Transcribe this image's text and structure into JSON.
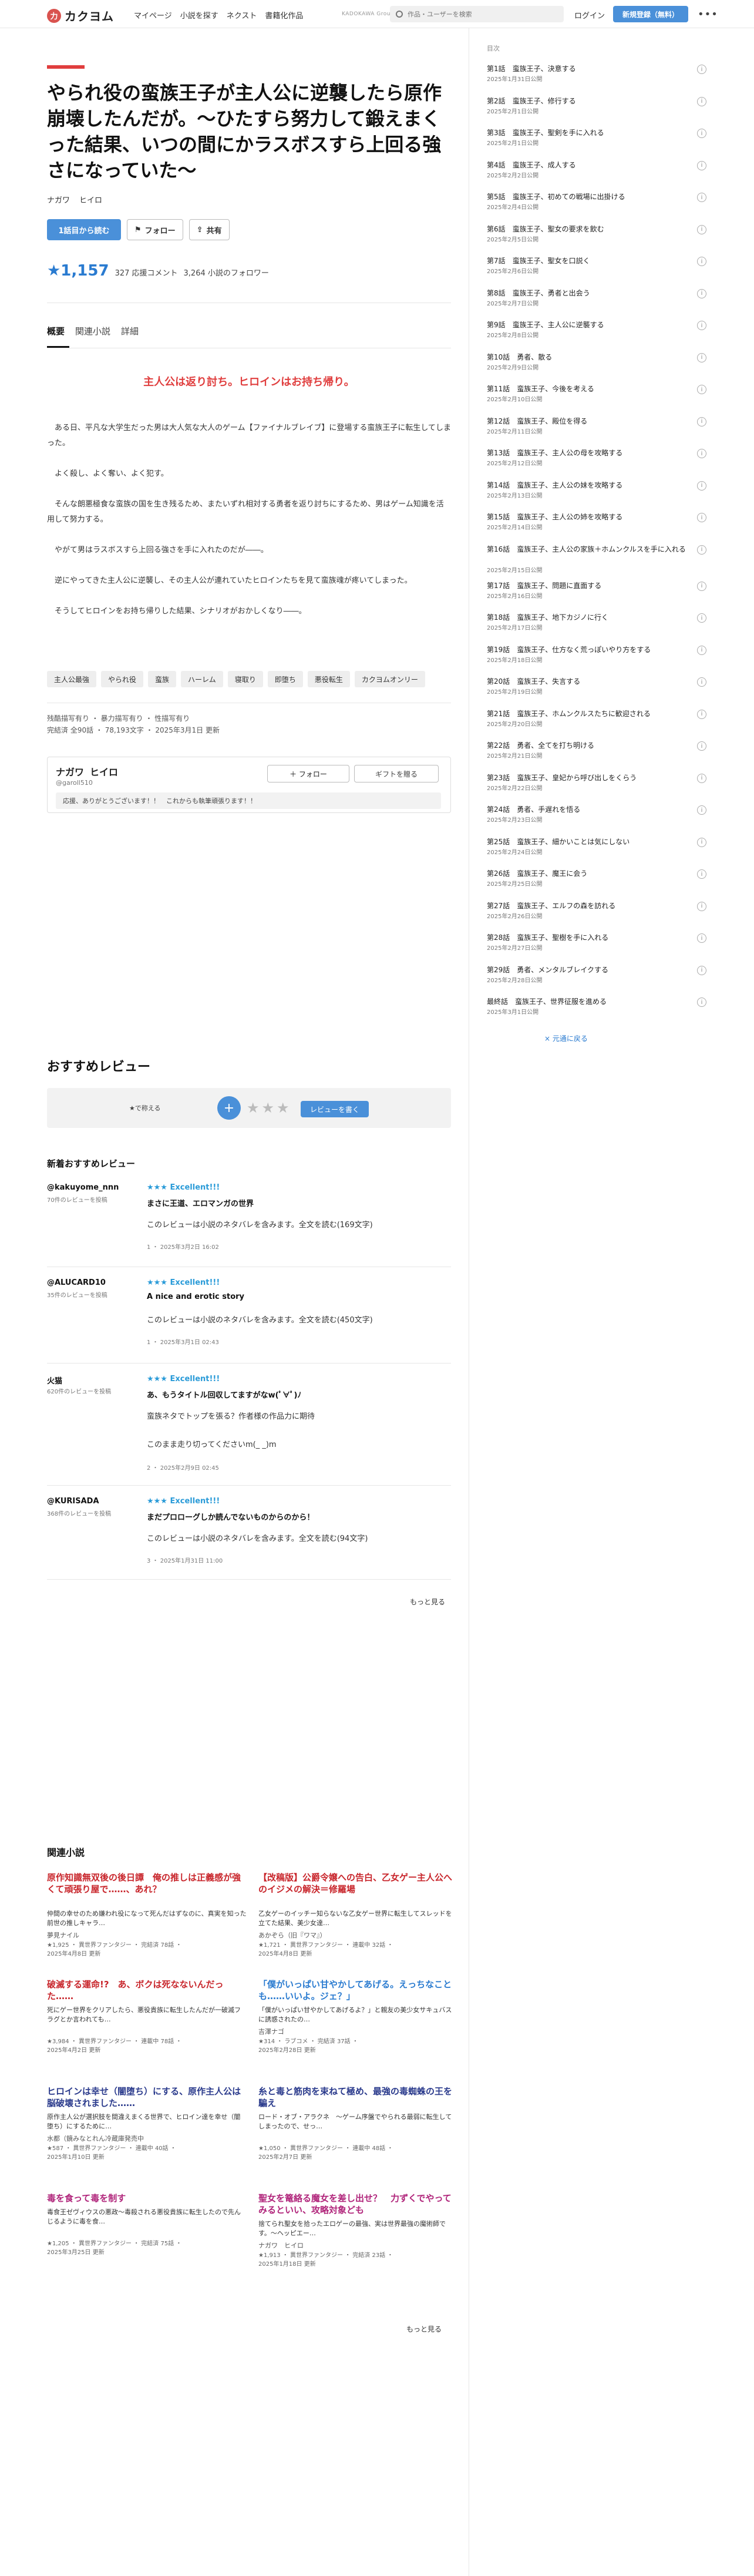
{
  "header": {
    "logo_mark": "力",
    "logo_text": "カクヨム",
    "nav": [
      "マイページ",
      "小説を探す",
      "ネクスト",
      "書籍化作品"
    ],
    "group_label": "KADOKAWA Group",
    "search_placeholder": "作品・ユーザーを検索",
    "login": "ログイン",
    "signup": "新規登録（無料）",
    "more": "•••"
  },
  "work": {
    "title": "やられ役の蛮族王子が主人公に逆襲したら原作崩壊したんだが。～ひたすら努力して鍛えまくった結果、いつの間にかラスボスすら上回る強さになっていた～",
    "author_last": "ナガワ",
    "author_first": "ヒイロ",
    "read_button": "1話目から読む",
    "follow_button": "フォロー",
    "share_button": "共有",
    "stars": "★1,157",
    "comments": "327 応援コメント",
    "followers": "3,264 小説のフォロワー"
  },
  "tabs": [
    "概要",
    "関連小説",
    "詳細"
  ],
  "catchphrase": "主人公は返り討ち。ヒロインはお持ち帰り。",
  "intro": [
    "ある日、平凡な大学生だった男は大人気な大人のゲーム【ファイナルブレイブ】に登場する蛮族王子に転生してしまった。",
    "よく殺し、よく奪い、よく犯す。",
    "そんな朗悪極食な蛮族の国を生き残るため、またいずれ相対する勇者を返り討ちにするため、男はゲーム知識を活用して努力する。",
    "やがて男はラスボスすら上回る強さを手に入れたのだが――。",
    "逆にやってきた主人公に逆襲し、その主人公が連れていたヒロインたちを見て蛮族魂が疼いてしまった。",
    "そうしてヒロインをお持ち帰りした結果、シナリオがおかしくなり――。"
  ],
  "tags": [
    "主人公最強",
    "やられ役",
    "蛮族",
    "ハーレム",
    "寝取り",
    "即堕ち",
    "悪役転生",
    "カクヨムオンリー"
  ],
  "meta": {
    "line1": "残酷描写有り ・ 暴力描写有り ・ 性描写有り",
    "line2": "完結済 全90話 ・ 78,193文字 ・ 2025年3月1日 更新"
  },
  "author_box": {
    "name_last": "ナガワ",
    "name_first": "ヒイロ",
    "id": "@garoll510",
    "follow": "＋ フォロー",
    "gift": "ギフトを贈る",
    "message": "応援、ありがとうございます！！　これからも執筆頑張ります！！"
  },
  "reviews_section": {
    "title": "おすすめレビュー",
    "label": "★で称える",
    "plus": "+",
    "stars": "★★★",
    "write_button": "レビューを書く",
    "sub_title": "新着おすすめレビュー",
    "more": "もっと見る",
    "items": [
      {
        "user": "@kakuyome_nnn",
        "sub": "70件のレビューを投稿",
        "rating": "★★★ Excellent!!!",
        "headline": "まさに王道、エロマンガの世界",
        "body": [
          "このレビューは小説のネタバレを含みます。全文を読む(169文字)"
        ],
        "foot": "1 ・ 2025年3月2日 16:02"
      },
      {
        "user": "@ALUCARD10",
        "sub": "35件のレビューを投稿",
        "rating": "★★★ Excellent!!!",
        "headline": "A nice and erotic story",
        "body": [
          "このレビューは小説のネタバレを含みます。全文を読む(450文字)"
        ],
        "foot": "1 ・ 2025年3月1日 02:43"
      },
      {
        "user": "火猫",
        "sub": "620件のレビューを投稿",
        "rating": "★★★ Excellent!!!",
        "headline": "あ、もうタイトル回収してますがなw(ﾟ∀ﾟ)ﾉ",
        "body": [
          "蛮族ネタでトップを張る？作者様の作品力に期待",
          "",
          "このまま走り切ってくださいm(_ _)m"
        ],
        "foot": "2 ・ 2025年2月9日 02:45"
      },
      {
        "user": "@KURISADA",
        "sub": "368件のレビューを投稿",
        "rating": "★★★ Excellent!!!",
        "headline": "まだプロローグしか読んでないものからのから！",
        "body": [
          "このレビューは小説のネタバレを含みます。全文を読む(94文字)"
        ],
        "foot": "3 ・ 2025年1月31日 11:00"
      }
    ]
  },
  "related": {
    "title": "関連小説",
    "more": "もっと見る",
    "items": [
      {
        "title": "原作知識無双後の後日譚　俺の推しは正義感が強くて頑張り屋で……、あれ？",
        "color": "#c8252b",
        "desc": "仲間の幸せのため嫌われ役になって死んだはずなのに、真実を知った前世の推しキャラ…",
        "author": "夢見ナイル",
        "meta": [
          "★1,925 ・ 異世界ファンタジー ・ 完結済 78話 ・",
          "2025年4月8日 更新"
        ]
      },
      {
        "title": "【改稿版】公爵令嬢への告白、乙女ゲー主人公へのイジメの解決＝修羅場",
        "color": "#c8252b",
        "desc": "乙女ゲーのイッチー知らないな乙女ゲー世界に転生してスレッドを立てた結果、美少女達…",
        "author": "あかぞら（旧『ワマ』）",
        "meta": [
          "★1,721 ・ 異世界ファンタジー ・ 連載中 32話 ・",
          "2025年4月8日 更新"
        ]
      },
      {
        "title": "破滅する運命!?　あ、ボクは死なないんだった……",
        "color": "#c8252b",
        "desc": "死にゲー世界をクリアしたら、悪役貴族に転生したんだが一破滅フラグとか言われても…",
        "author": "",
        "meta": [
          "★3,984 ・ 異世界ファンタジー ・ 連載中 78話 ・",
          "2025年4月2日 更新"
        ]
      },
      {
        "title": "「僕がいっぱい甘やかしてあげる。えっちなことも……いいよ。ジェ？」",
        "color": "#2a7bd0",
        "desc": "「僕がいっぱい甘やかしてあげるよ？」と親友の美少女サキュバスに誘惑されたの…",
        "author": "吉澤ナゴ",
        "meta": [
          "★314 ・ ラブコメ ・ 完結済 37話 ・",
          "2025年2月28日 更新"
        ]
      },
      {
        "title": "ヒロインは幸せ（闇堕ち）にする、原作主人公は脳破壊されました……",
        "color": "#2a3a8c",
        "desc": "原作主人公が選択肢を間違えまくる世界で、ヒロイン達を幸せ（闇堕ち）にするために…",
        "author": "水都（鏡みなとれん冷蔵庫発売中",
        "meta": [
          "★587 ・ 異世界ファンタジー ・ 連載中 40話 ・",
          "2025年1月10日 更新"
        ]
      },
      {
        "title": "糸と毒と筋肉を束ねて極め、最強の毒蜘蛛の王を騙え",
        "color": "#2a3a8c",
        "desc": "ロード・オブ・アラクネ　〜ゲーム序盤でやられる最弱に転生してしまったので、せっ…",
        "author": "",
        "meta": [
          "★1,050 ・ 異世界ファンタジー ・ 連載中 48話 ・",
          "2025年2月7日 更新"
        ]
      },
      {
        "title": "毒を食って毒を制す",
        "color": "#b0247a",
        "desc": "毒食王ゼヴィウスの悪政～毒殺される悪役貴族に転生したので先んじるように毒を食…",
        "author": "",
        "meta": [
          "★1,205 ・ 異世界ファンタジー ・ 完結済 75話 ・",
          "2025年3月25日 更新"
        ]
      },
      {
        "title": "聖女を篭絡る魔女を差し出せ？　力ずくでやってみるといい、攻略対象ども",
        "color": "#b0247a",
        "desc": "捨てられ聖女を拾ったエロゲーの最強、実は世界最強の魔術師です。〜ヘッピエー…",
        "author": "ナガワ　ヒイロ",
        "meta": [
          "★1,913 ・ 異世界ファンタジー ・ 完結済 23話 ・",
          "2025年1月18日 更新"
        ]
      }
    ]
  },
  "toc": {
    "head": "目次",
    "close": "× 元通に戻る",
    "episodes": [
      {
        "title": "第1話　蛮族王子、決意する",
        "date": "2025年1月31日公開"
      },
      {
        "title": "第2話　蛮族王子、修行する",
        "date": "2025年2月1日公開"
      },
      {
        "title": "第3話　蛮族王子、聖剣を手に入れる",
        "date": "2025年2月1日公開"
      },
      {
        "title": "第4話　蛮族王子、成人する",
        "date": "2025年2月2日公開"
      },
      {
        "title": "第5話　蛮族王子、初めての戦場に出掛ける",
        "date": "2025年2月4日公開"
      },
      {
        "title": "第6話　蛮族王子、聖女の要求を飲む",
        "date": "2025年2月5日公開"
      },
      {
        "title": "第7話　蛮族王子、聖女を口説く",
        "date": "2025年2月6日公開"
      },
      {
        "title": "第8話　蛮族王子、勇者と出会う",
        "date": "2025年2月7日公開"
      },
      {
        "title": "第9話　蛮族王子、主人公に逆襲する",
        "date": "2025年2月8日公開"
      },
      {
        "title": "第10話　勇者、散る",
        "date": "2025年2月9日公開"
      },
      {
        "title": "第11話　蛮族王子、今後を考える",
        "date": "2025年2月10日公開"
      },
      {
        "title": "第12話　蛮族王子、殿位を得る",
        "date": "2025年2月11日公開"
      },
      {
        "title": "第13話　蛮族王子、主人公の母を攻略する",
        "date": "2025年2月12日公開"
      },
      {
        "title": "第14話　蛮族王子、主人公の妹を攻略する",
        "date": "2025年2月13日公開"
      },
      {
        "title": "第15話　蛮族王子、主人公の姉を攻略する",
        "date": "2025年2月14日公開"
      },
      {
        "title": "第16話　蛮族王子、主人公の家族＋ホムンクルスを手に入れる",
        "date": "2025年2月15日公開"
      },
      {
        "title": "第17話　蛮族王子、問題に直面する",
        "date": "2025年2月16日公開"
      },
      {
        "title": "第18話　蛮族王子、地下カジノに行く",
        "date": "2025年2月17日公開"
      },
      {
        "title": "第19話　蛮族王子、仕方なく荒っぽいやり方をする",
        "date": "2025年2月18日公開"
      },
      {
        "title": "第20話　蛮族王子、失言する",
        "date": "2025年2月19日公開"
      },
      {
        "title": "第21話　蛮族王子、ホムンクルスたちに歓迎される",
        "date": "2025年2月20日公開"
      },
      {
        "title": "第22話　勇者、全てを打ち明ける",
        "date": "2025年2月21日公開"
      },
      {
        "title": "第23話　蛮族王子、皇妃から呼び出しをくらう",
        "date": "2025年2月22日公開"
      },
      {
        "title": "第24話　勇者、手遅れを悟る",
        "date": "2025年2月23日公開"
      },
      {
        "title": "第25話　蛮族王子、細かいことは気にしない",
        "date": "2025年2月24日公開"
      },
      {
        "title": "第26話　蛮族王子、魔王に会う",
        "date": "2025年2月25日公開"
      },
      {
        "title": "第27話　蛮族王子、エルフの森を訪れる",
        "date": "2025年2月26日公開"
      },
      {
        "title": "第28話　蛮族王子、聖樹を手に入れる",
        "date": "2025年2月27日公開"
      },
      {
        "title": "第29話　勇者、メンタルブレイクする",
        "date": "2025年2月28日公開"
      },
      {
        "title": "最終話　蛮族王子、世界征服を進める",
        "date": "2025年3月1日公開"
      }
    ]
  }
}
